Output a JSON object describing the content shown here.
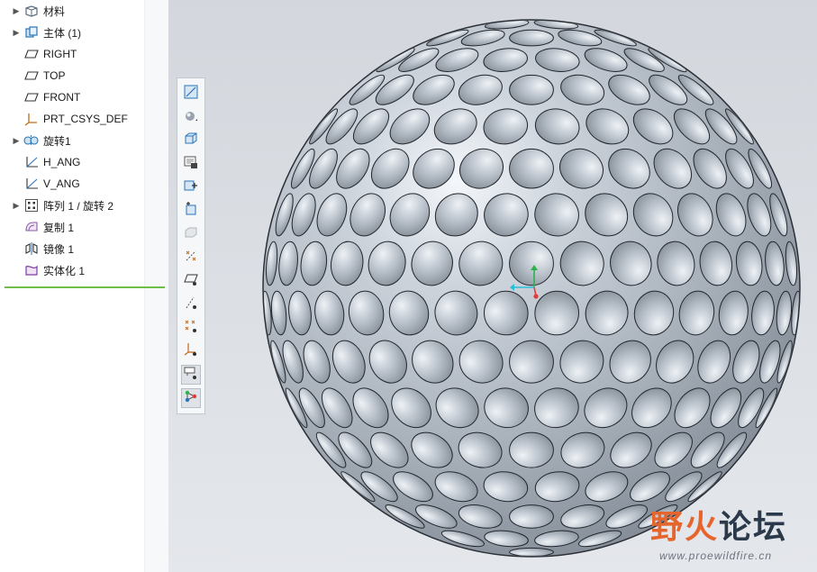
{
  "model_tree": {
    "items": [
      {
        "label": "材料",
        "icon": "material-icon",
        "expandable": true
      },
      {
        "label": "主体 (1)",
        "icon": "body-icon",
        "expandable": true
      },
      {
        "label": "RIGHT",
        "icon": "datum-plane-icon",
        "expandable": false
      },
      {
        "label": "TOP",
        "icon": "datum-plane-icon",
        "expandable": false
      },
      {
        "label": "FRONT",
        "icon": "datum-plane-icon",
        "expandable": false
      },
      {
        "label": "PRT_CSYS_DEF",
        "icon": "coordinate-system-icon",
        "expandable": false
      },
      {
        "label": "旋转1",
        "icon": "revolve-icon",
        "expandable": true
      },
      {
        "label": "H_ANG",
        "icon": "datum-axis-icon",
        "expandable": false
      },
      {
        "label": "V_ANG",
        "icon": "datum-axis-icon",
        "expandable": false
      },
      {
        "label": "阵列 1 / 旋转 2",
        "icon": "pattern-icon",
        "expandable": true
      },
      {
        "label": "复制 1",
        "icon": "copy-icon",
        "expandable": false
      },
      {
        "label": "镜像 1",
        "icon": "mirror-icon",
        "expandable": false
      },
      {
        "label": "实体化 1",
        "icon": "solidify-icon",
        "expandable": false
      }
    ]
  },
  "view_toolbar": {
    "buttons": [
      {
        "icon": "refit-icon"
      },
      {
        "icon": "display-style-icon"
      },
      {
        "icon": "saved-views-icon"
      },
      {
        "icon": "view-manager-icon"
      },
      {
        "icon": "zoom-in-icon"
      },
      {
        "icon": "zoom-out-icon"
      },
      {
        "icon": "repaint-icon"
      },
      {
        "icon": "datum-display-icon"
      },
      {
        "icon": "plane-display-icon"
      },
      {
        "icon": "axis-display-icon"
      },
      {
        "icon": "point-display-icon"
      },
      {
        "icon": "csys-display-icon"
      },
      {
        "icon": "annotation-display-icon"
      },
      {
        "icon": "spin-center-icon"
      }
    ]
  },
  "colors": {
    "insert_line": "#6cc04a",
    "ball_base": "#a9b1bb",
    "watermark_orange": "#e5652d",
    "watermark_dark": "#2b3a4a"
  },
  "watermark": {
    "logo_part1": "野火",
    "logo_part2": "论坛",
    "url": "www.proewildfire.cn"
  }
}
